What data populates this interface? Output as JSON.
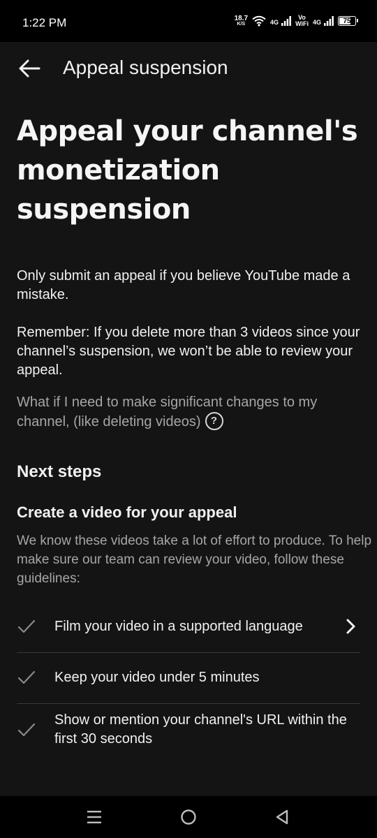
{
  "status_bar": {
    "time": "1:22 PM",
    "net_speed_value": "18.7",
    "net_speed_unit": "K/S",
    "network_1": "4G",
    "vowifi_top": "Vo",
    "vowifi_bottom": "WiFi",
    "network_2": "4G",
    "battery_level": "75",
    "icons": [
      "wifi-icon",
      "signal-icon",
      "signal-icon",
      "battery-icon"
    ]
  },
  "app_bar": {
    "back_icon": "arrow-left-icon",
    "title": "Appeal suspension"
  },
  "content": {
    "headline": "Appeal your channel's monetization suspension",
    "paragraph_1": "Only submit an appeal if you believe YouTube made a mistake.",
    "paragraph_2": "Remember: If you delete more than 3 videos since your channel’s suspension, we won’t be able to review your appeal.",
    "help_link": "What if I need to make significant changes to my channel, (like deleting videos)",
    "help_icon": "question-mark-icon",
    "next_steps_title": "Next steps",
    "create_video_title": "Create a video for your appeal",
    "create_video_desc": "We know these videos take a lot of effort to produce. To help make sure our team can review your video, follow these guidelines:",
    "guidelines": [
      {
        "label": "Film your video in a supported language",
        "has_chevron": true
      },
      {
        "label": "Keep your video under 5 minutes",
        "has_chevron": false
      },
      {
        "label": "Show or mention your channel's URL within the first 30 seconds",
        "has_chevron": false
      }
    ]
  },
  "nav_bar": {
    "icons": [
      "menu-icon",
      "home-circle-icon",
      "back-triangle-icon"
    ]
  },
  "colors": {
    "background": "#141414",
    "text_primary": "#f1f1f1",
    "text_secondary": "#a6a6a6",
    "divider": "#3a3a3a"
  }
}
